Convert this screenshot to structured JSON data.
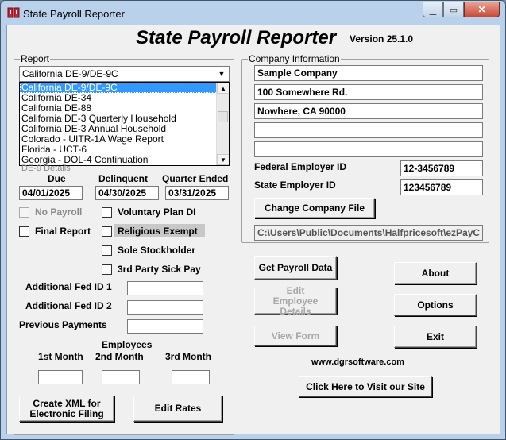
{
  "window": {
    "title": "State Payroll Reporter"
  },
  "header": {
    "app_title": "State Payroll Reporter",
    "version": "Version 25.1.0"
  },
  "report": {
    "group_label": "Report",
    "selected": "California DE-9/DE-9C",
    "items": [
      "California DE-9/DE-9C",
      "California DE-34",
      "California DE-88",
      "California DE-3 Quarterly Household",
      "California DE-3 Annual Household",
      "Colorado - UITR-1A Wage Report",
      "Florida - UCT-6",
      "Georgia - DOL-4 Continuation"
    ],
    "details_label": "DE-9 Details",
    "due_label": "Due",
    "due_value": "04/01/2025",
    "delinquent_label": "Delinquent",
    "delinquent_value": "04/30/2025",
    "quarter_ended_label": "Quarter Ended",
    "quarter_ended_value": "03/31/2025",
    "no_payroll": "No Payroll",
    "final_report": "Final Report",
    "voluntary_plan": "Voluntary Plan DI",
    "religious_exempt": "Religious Exempt",
    "sole_stockholder": "Sole Stockholder",
    "third_party_sick_pay": "3rd Party Sick Pay",
    "additional_fed_id_1": "Additional Fed ID 1",
    "additional_fed_id_2": "Additional Fed ID 2",
    "previous_payments": "Previous Payments",
    "employees_label": "Employees",
    "month_1": "1st Month",
    "month_2": "2nd Month",
    "month_3": "3rd Month",
    "create_xml": "Create XML for Electronic Filing",
    "edit_rates": "Edit Rates"
  },
  "company": {
    "group_label": "Company Information",
    "name": "Sample Company",
    "address1": "100 Somewhere Rd.",
    "address2": "Nowhere, CA 90000",
    "address3": "",
    "address4": "",
    "federal_label": "Federal Employer ID",
    "federal_value": "12-3456789",
    "state_label": "State Employer ID",
    "state_value": "123456789",
    "change_file": "Change Company File",
    "file_path": "C:\\Users\\Public\\Documents\\Halfpricesoft\\ezPayC"
  },
  "actions": {
    "get_payroll": "Get Payroll Data",
    "edit_employee": "Edit Employee Details",
    "view_form": "View Form",
    "about": "About",
    "options": "Options",
    "exit": "Exit",
    "website": "www.dgrsoftware.com",
    "visit_site": "Click Here to Visit our Site"
  }
}
